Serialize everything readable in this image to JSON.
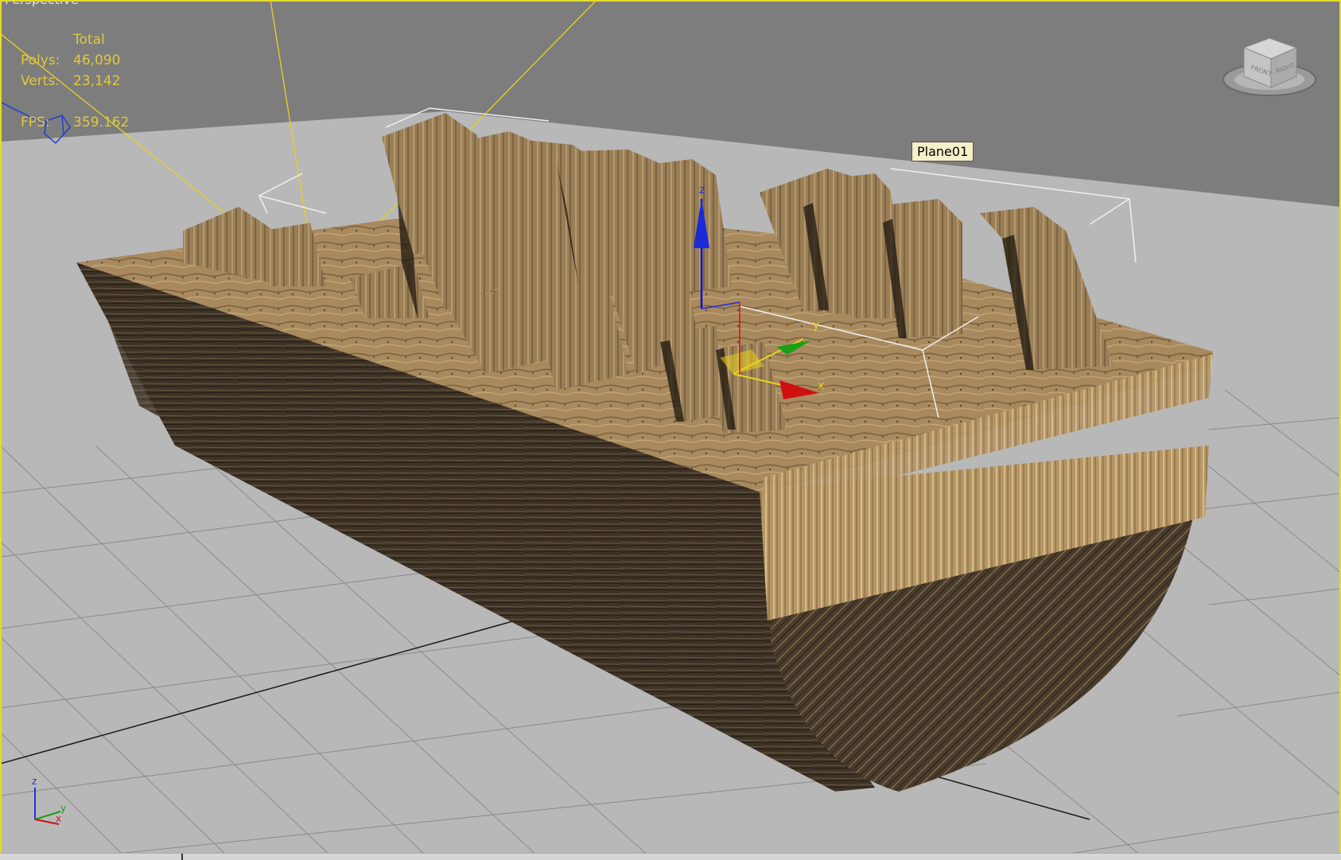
{
  "viewport": {
    "label": "Perspective",
    "border_color": "#e2dc2a",
    "background_color": "#7d7d7d",
    "ground_color": "#b8b8b8"
  },
  "stats": {
    "header": "Total",
    "polys_label": "Polys:",
    "polys_value": "46,090",
    "verts_label": "Verts:",
    "verts_value": "23,142",
    "fps_label": "FPS:",
    "fps_value": "359.162",
    "text_color": "#e2c83c"
  },
  "tooltip": {
    "object_name": "Plane01"
  },
  "gizmo": {
    "axis_z": "z",
    "axis_y": "y",
    "axis_x": "x",
    "color_x": "#d01010",
    "color_y": "#10a010",
    "color_z": "#1010d0"
  },
  "viewcube": {
    "face_front": "FRONT",
    "face_right": "RIGHT",
    "icon": "viewcube-icon"
  },
  "axis_tripod": {
    "z": "z",
    "y": "y",
    "x": "x"
  }
}
